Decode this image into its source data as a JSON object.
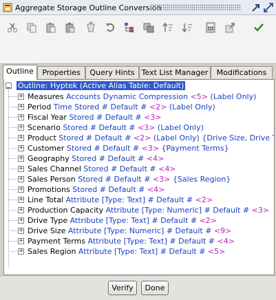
{
  "window": {
    "title": "Aggregate Storage Outline Conversion"
  },
  "tabs": [
    {
      "label": "Outline"
    },
    {
      "label": "Properties"
    },
    {
      "label": "Query Hints"
    },
    {
      "label": "Text List Manager"
    },
    {
      "label": "Modifications"
    }
  ],
  "tree": {
    "root": "Outline: Hyptek (Active Alias Table: Default)",
    "nodes": [
      {
        "name": "Measures",
        "blue": " Accounts Dynamic  Compression ",
        "mag": "<5>",
        "rest": " (Label Only)"
      },
      {
        "name": "Period",
        "blue": " Time Stored # Default # ",
        "mag": "<2>",
        "rest": " (Label Only)"
      },
      {
        "name": "Fiscal Year",
        "blue": " Stored # Default # ",
        "mag": "<3>",
        "rest": ""
      },
      {
        "name": "Scenario",
        "blue": " Stored # Default # ",
        "mag": "<3>",
        "rest": " (Label Only)"
      },
      {
        "name": "Product",
        "blue": " Stored # Default # ",
        "mag": "<2>",
        "rest": " (Label Only) {Drive Size, Drive Type, Line Total}"
      },
      {
        "name": "Customer",
        "blue": " Stored # Default # ",
        "mag": "<3>",
        "rest": " {Payment Terms}"
      },
      {
        "name": "Geography",
        "blue": " Stored # Default # ",
        "mag": "<4>",
        "rest": ""
      },
      {
        "name": "Sales Channel",
        "blue": " Stored # Default # ",
        "mag": "<4>",
        "rest": ""
      },
      {
        "name": "Sales Person",
        "blue": " Stored # Default # ",
        "mag": "<3>",
        "rest": " {Sales Region}"
      },
      {
        "name": "Promotions",
        "blue": " Stored # Default # ",
        "mag": "<4>",
        "rest": ""
      },
      {
        "name": "Line Total",
        "blue": " Attribute [Type: Text] # Default # ",
        "mag": "<2>",
        "rest": ""
      },
      {
        "name": "Production Capacity",
        "blue": " Attribute [Type: Numeric] # Default # ",
        "mag": "<3>",
        "rest": ""
      },
      {
        "name": "Drive Type",
        "blue": " Attribute [Type: Text] # Default # ",
        "mag": "<2>",
        "rest": ""
      },
      {
        "name": "Drive Size",
        "blue": " Attribute [Type: Numeric] # Default # ",
        "mag": "<9>",
        "rest": ""
      },
      {
        "name": "Payment Terms",
        "blue": " Attribute [Type: Text] # Default # ",
        "mag": "<4>",
        "rest": ""
      },
      {
        "name": "Sales Region",
        "blue": " Attribute [Type: Text] # Default # ",
        "mag": "<5>",
        "rest": ""
      }
    ]
  },
  "buttons": {
    "verify": "Verify",
    "done": "Done"
  },
  "colors": {
    "blue": "#1a3fc4",
    "magenta": "#c020c0",
    "selection": "#2c59c8"
  },
  "toolbar_icons": [
    "cut-icon",
    "copy-icon",
    "paste-icon",
    "paste-special-icon",
    "delete-icon",
    "undo-icon",
    "tree-icon",
    "format-icon",
    "sort-ascending-icon",
    "sort-descending-icon",
    "calculator-icon",
    "export-icon",
    "check-icon"
  ]
}
